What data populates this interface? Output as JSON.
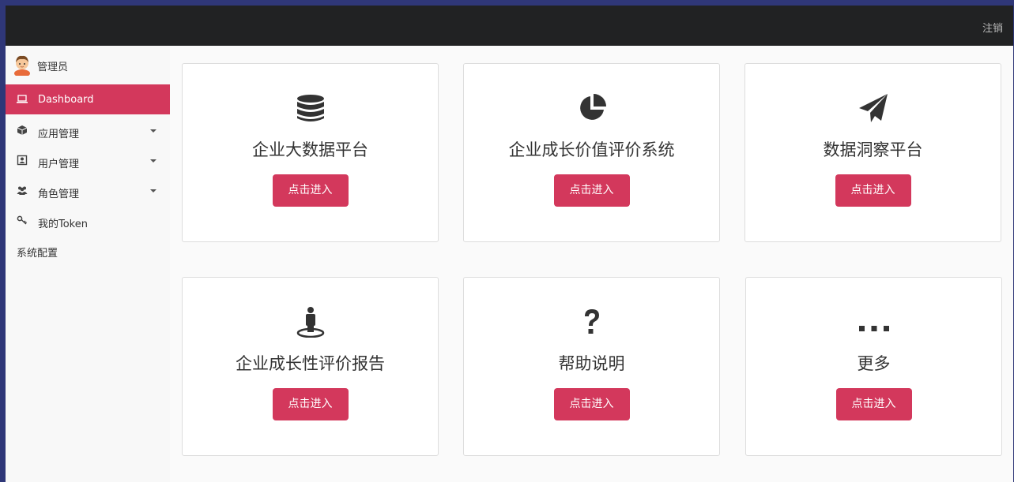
{
  "header": {
    "logout_label": "注销"
  },
  "sidebar": {
    "user_name": "管理员",
    "items": [
      {
        "label": "Dashboard"
      },
      {
        "label": "应用管理"
      },
      {
        "label": "用户管理"
      },
      {
        "label": "角色管理"
      },
      {
        "label": "我的Token"
      },
      {
        "label": "系统配置"
      }
    ]
  },
  "cards": [
    {
      "title": "企业大数据平台",
      "icon": "database-icon",
      "button": "点击进入"
    },
    {
      "title": "企业成长价值评价系统",
      "icon": "pie-chart-icon",
      "button": "点击进入"
    },
    {
      "title": "数据洞察平台",
      "icon": "paper-plane-icon",
      "button": "点击进入"
    },
    {
      "title": "企业成长性评价报告",
      "icon": "street-view-icon",
      "button": "点击进入"
    },
    {
      "title": "帮助说明",
      "icon": "question-icon",
      "button": "点击进入"
    },
    {
      "title": "更多",
      "icon": "ellipsis-icon",
      "button": "点击进入"
    }
  ],
  "colors": {
    "accent": "#d3385c",
    "topbar": "#212223",
    "sidebar_bg": "#f8f8f8"
  }
}
